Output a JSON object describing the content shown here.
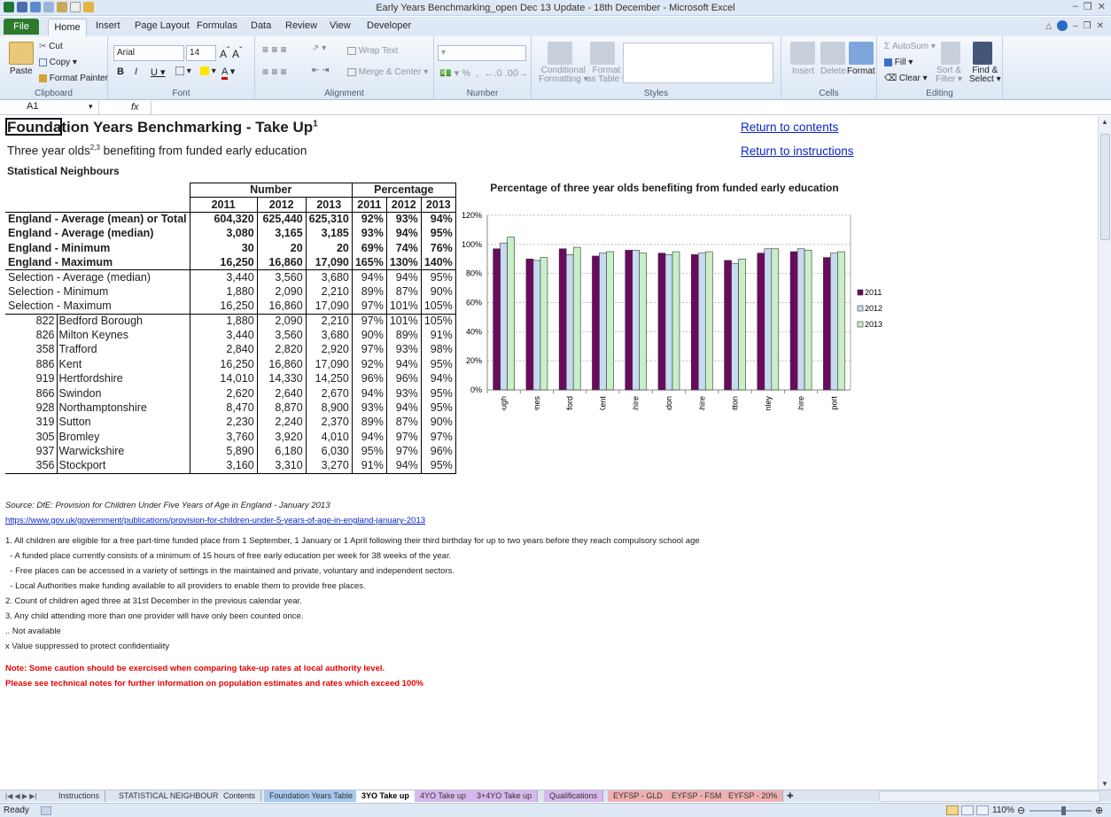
{
  "window": {
    "title": "Early Years Benchmarking_open Dec 13 Update - 18th December - Microsoft Excel"
  },
  "ribbon": {
    "tabs": [
      "Home",
      "Insert",
      "Page Layout",
      "Formulas",
      "Data",
      "Review",
      "View",
      "Developer"
    ],
    "file_tab": "File",
    "clipboard": {
      "paste": "Paste",
      "cut": "Cut",
      "copy": "Copy",
      "format_painter": "Format Painter",
      "label": "Clipboard"
    },
    "font": {
      "name": "Arial",
      "size": "14",
      "label": "Font"
    },
    "alignment": {
      "wrap_text": "Wrap Text",
      "merge_center": "Merge & Center",
      "label": "Alignment"
    },
    "number": {
      "label": "Number",
      "percent": "%",
      "comma": ","
    },
    "styles": {
      "conditional": "Conditional",
      "formatting": "Formatting",
      "format_as": "Format",
      "as_table": "as Table",
      "label": "Styles"
    },
    "cells": {
      "insert": "Insert",
      "delete": "Delete",
      "format": "Format",
      "label": "Cells"
    },
    "editing": {
      "autosum": "AutoSum",
      "fill": "Fill",
      "clear": "Clear",
      "sort": "Sort &",
      "filter": "Filter",
      "find": "Find &",
      "select": "Select",
      "label": "Editing"
    }
  },
  "formula_bar": {
    "name_box": "A1",
    "fx": "fx"
  },
  "sheet": {
    "title": "Foundation Years Benchmarking - Take Up",
    "title_sup": "1",
    "subtitle": "Three year olds",
    "subtitle_sup": "2,3",
    "subtitle_rest": " benefiting from funded early education",
    "heading": "Statistical Neighbours",
    "link_contents": "Return to contents",
    "link_instructions": "Return to instructions"
  },
  "table": {
    "group_headers": [
      "Number",
      "Percentage"
    ],
    "years": [
      "2011",
      "2012",
      "2013",
      "2011",
      "2012",
      "2013"
    ],
    "summary_rows": [
      {
        "label": "England - Average (mean) or Total",
        "values": [
          "604,320",
          "625,440",
          "625,310",
          "92%",
          "93%",
          "94%"
        ]
      },
      {
        "label": "England - Average (median)",
        "values": [
          "3,080",
          "3,165",
          "3,185",
          "93%",
          "94%",
          "95%"
        ]
      },
      {
        "label": "England - Minimum",
        "values": [
          "30",
          "20",
          "20",
          "69%",
          "74%",
          "76%"
        ]
      },
      {
        "label": "England - Maximum",
        "values": [
          "16,250",
          "16,860",
          "17,090",
          "165%",
          "130%",
          "140%"
        ]
      },
      {
        "label": "Selection - Average (median)",
        "values": [
          "3,440",
          "3,560",
          "3,680",
          "94%",
          "94%",
          "95%"
        ]
      },
      {
        "label": "Selection - Minimum",
        "values": [
          "1,880",
          "2,090",
          "2,210",
          "89%",
          "87%",
          "90%"
        ]
      },
      {
        "label": "Selection - Maximum",
        "values": [
          "16,250",
          "16,860",
          "17,090",
          "97%",
          "101%",
          "105%"
        ]
      }
    ],
    "la_rows": [
      {
        "code": "822",
        "name": "Bedford Borough",
        "values": [
          "1,880",
          "2,090",
          "2,210",
          "97%",
          "101%",
          "105%"
        ]
      },
      {
        "code": "826",
        "name": "Milton Keynes",
        "values": [
          "3,440",
          "3,560",
          "3,680",
          "90%",
          "89%",
          "91%"
        ]
      },
      {
        "code": "358",
        "name": "Trafford",
        "values": [
          "2,840",
          "2,820",
          "2,920",
          "97%",
          "93%",
          "98%"
        ]
      },
      {
        "code": "886",
        "name": "Kent",
        "values": [
          "16,250",
          "16,860",
          "17,090",
          "92%",
          "94%",
          "95%"
        ]
      },
      {
        "code": "919",
        "name": "Hertfordshire",
        "values": [
          "14,010",
          "14,330",
          "14,250",
          "96%",
          "96%",
          "94%"
        ]
      },
      {
        "code": "866",
        "name": "Swindon",
        "values": [
          "2,620",
          "2,640",
          "2,670",
          "94%",
          "93%",
          "95%"
        ]
      },
      {
        "code": "928",
        "name": "Northamptonshire",
        "values": [
          "8,470",
          "8,870",
          "8,900",
          "93%",
          "94%",
          "95%"
        ]
      },
      {
        "code": "319",
        "name": "Sutton",
        "values": [
          "2,230",
          "2,240",
          "2,370",
          "89%",
          "87%",
          "90%"
        ]
      },
      {
        "code": "305",
        "name": "Bromley",
        "values": [
          "3,760",
          "3,920",
          "4,010",
          "94%",
          "97%",
          "97%"
        ]
      },
      {
        "code": "937",
        "name": "Warwickshire",
        "values": [
          "5,890",
          "6,180",
          "6,030",
          "95%",
          "97%",
          "96%"
        ]
      },
      {
        "code": "356",
        "name": "Stockport",
        "values": [
          "3,160",
          "3,310",
          "3,270",
          "91%",
          "94%",
          "95%"
        ]
      }
    ]
  },
  "chart_data": {
    "type": "bar",
    "title": "Percentage of three year olds benefiting from funded early education",
    "categories": [
      "Bedford Borough",
      "Milton Keynes",
      "Trafford",
      "Kent",
      "Hertfordshire",
      "Swindon",
      "Northamptonshire",
      "Sutton",
      "Bromley",
      "Warwickshire",
      "Stockport"
    ],
    "series": [
      {
        "name": "2011",
        "color": "#6a0a5e",
        "values": [
          97,
          90,
          97,
          92,
          96,
          94,
          93,
          89,
          94,
          95,
          91
        ]
      },
      {
        "name": "2012",
        "color": "#c8daf0",
        "values": [
          101,
          89,
          93,
          94,
          96,
          93,
          94,
          87,
          97,
          97,
          94
        ]
      },
      {
        "name": "2013",
        "color": "#c8f0c8",
        "values": [
          105,
          91,
          98,
          95,
          94,
          95,
          95,
          90,
          97,
          96,
          95
        ]
      }
    ],
    "y_ticks": [
      "0%",
      "20%",
      "40%",
      "60%",
      "80%",
      "100%",
      "120%"
    ],
    "ylim": [
      0,
      120
    ],
    "grid": true,
    "legend": "right"
  },
  "notes": {
    "source": "Source: DfE: Provision for Children Under Five Years of Age in England - January 2013",
    "url": "https://www.gov.uk/government/publications/provision-for-children-under-5-years-of-age-in-england-january-2013",
    "lines": [
      "1. All children are eligible for a free part-time funded place from 1 September, 1 January or 1 April following their third birthday for up to two years before they reach compulsory school age",
      "  - A funded place currently consists of a minimum of 15 hours of free early education per week for 38 weeks of the year.",
      "  - Free places can be accessed in a variety of settings in the maintained and private, voluntary and independent sectors.",
      "  - Local Authorities make funding available to all providers to enable them to provide free places.",
      "2. Count of children aged three at 31st December in the previous calendar year.",
      "3. Any child attending more than one provider will have only been counted once.",
      ".. Not available",
      "x Value suppressed to protect confidentiality"
    ],
    "caution_1": "Note:  Some caution should be exercised when comparing take-up rates at local authority level.",
    "caution_2": "Please see technical notes for further information on population estimates and rates which exceed 100%"
  },
  "sheet_tabs": [
    "Instructions",
    "STATISTICAL NEIGHBOURS",
    "Contents",
    "Foundation Years Table",
    "3YO Take up",
    "4YO Take up",
    "3+4YO Take up",
    "Qualifications",
    "EYFSP - GLD",
    "EYFSP - FSM",
    "EYFSP - 20%"
  ],
  "sheet_tab_colors": [
    "#dde5f0",
    "#dde5f0",
    "#dde5f0",
    "#a8c8ec",
    "#ffffff",
    "#d8b8ec",
    "#d8b8ec",
    "#d8b8ec",
    "#f0b0b0",
    "#f0b0b0",
    "#f0b0b0"
  ],
  "active_tab": "3YO Take up",
  "status": {
    "ready": "Ready",
    "zoom": "110%"
  }
}
